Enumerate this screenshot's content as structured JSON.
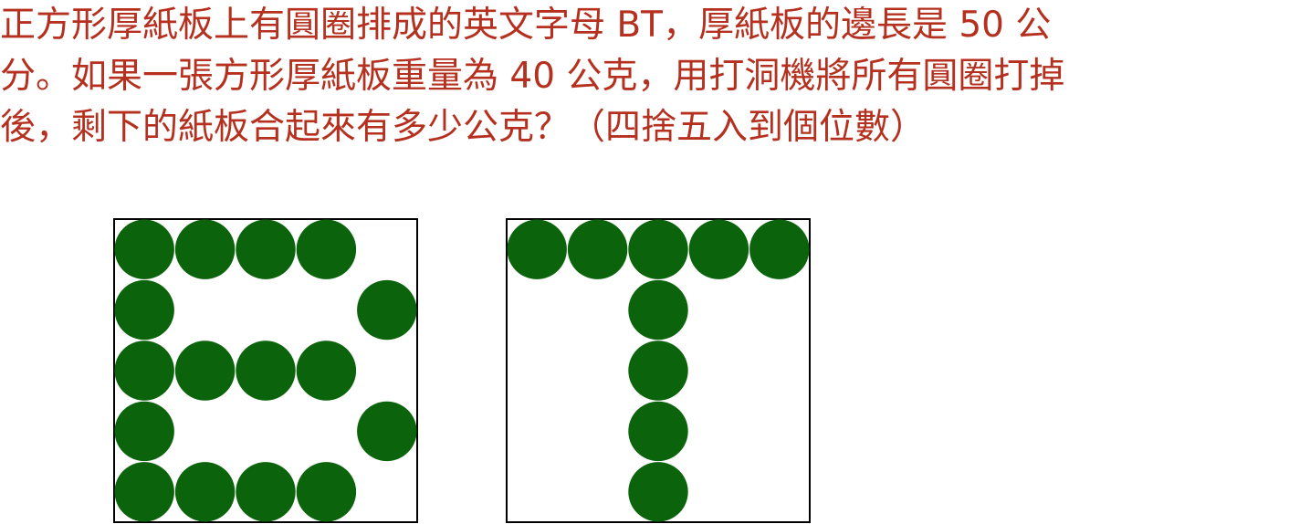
{
  "question": {
    "lines": [
      "正方形厚紙板上有圓圈排成的英文字母 BT，厚紙板的邊長是 50 公",
      "分。如果一張方形厚紙板重量為 40 公克，用打洞機將所有圓圈打掉",
      "後，剩下的紙板合起來有多少公克？（四捨五入到個位數）"
    ]
  },
  "figure": {
    "circle_color": "#0b640b",
    "text_color": "#b5301f",
    "border_color": "#000000",
    "grid_size": 5,
    "boards": [
      {
        "letter": "B",
        "filled_cells": [
          [
            0,
            0
          ],
          [
            0,
            1
          ],
          [
            0,
            2
          ],
          [
            0,
            3
          ],
          [
            1,
            0
          ],
          [
            1,
            4
          ],
          [
            2,
            0
          ],
          [
            2,
            1
          ],
          [
            2,
            2
          ],
          [
            2,
            3
          ],
          [
            3,
            0
          ],
          [
            3,
            4
          ],
          [
            4,
            0
          ],
          [
            4,
            1
          ],
          [
            4,
            2
          ],
          [
            4,
            3
          ]
        ]
      },
      {
        "letter": "T",
        "filled_cells": [
          [
            0,
            0
          ],
          [
            0,
            1
          ],
          [
            0,
            2
          ],
          [
            0,
            3
          ],
          [
            0,
            4
          ],
          [
            1,
            2
          ],
          [
            2,
            2
          ],
          [
            3,
            2
          ],
          [
            4,
            2
          ]
        ]
      }
    ]
  }
}
